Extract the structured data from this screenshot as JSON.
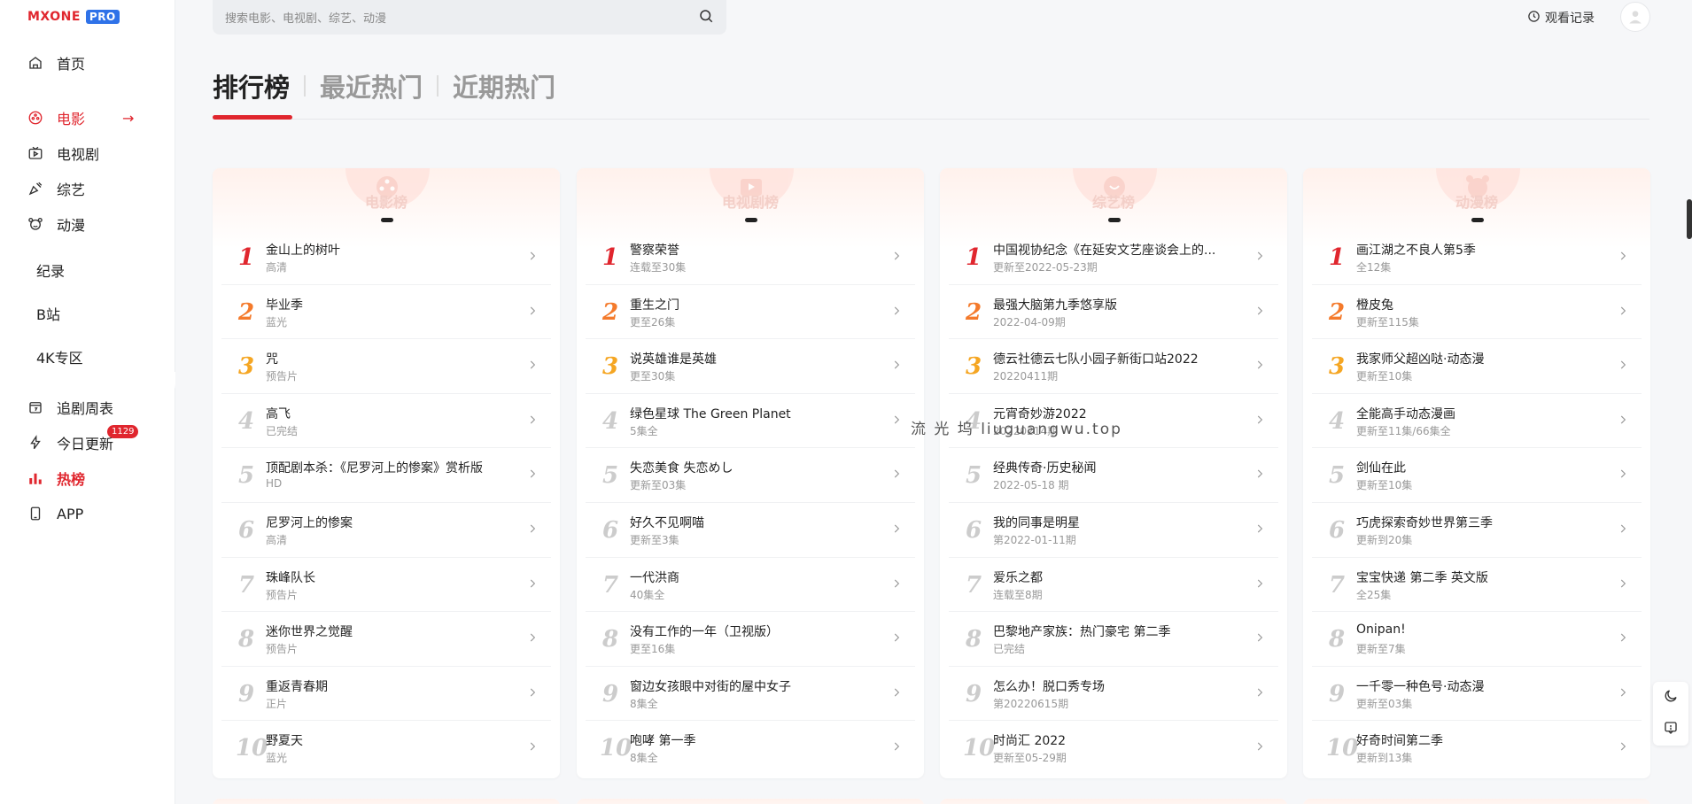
{
  "logo": {
    "brand": "MXONE",
    "pro": "PRO"
  },
  "search": {
    "placeholder": "搜索电影、电视剧、综艺、动漫"
  },
  "header": {
    "history_label": "观看记录"
  },
  "sidebar": {
    "items": [
      {
        "label": "首页",
        "icon": "home-icon"
      },
      {
        "label": "电影",
        "icon": "film-icon",
        "active": true
      },
      {
        "label": "电视剧",
        "icon": "tv-icon"
      },
      {
        "label": "综艺",
        "icon": "variety-icon"
      },
      {
        "label": "动漫",
        "icon": "anime-icon"
      }
    ],
    "subitems": [
      "纪录",
      "B站",
      "4K专区"
    ],
    "bottom_items": [
      {
        "label": "追剧周表",
        "icon": "calendar-icon"
      },
      {
        "label": "今日更新",
        "icon": "flash-icon",
        "badge": "1129"
      },
      {
        "label": "热榜",
        "icon": "chart-icon",
        "active": true
      },
      {
        "label": "APP",
        "icon": "phone-icon"
      }
    ]
  },
  "tabs": [
    "排行榜",
    "最近热门",
    "近期热门"
  ],
  "watermark": "流 光 坞 liuguangwu.top",
  "cards": [
    {
      "title": "电影榜",
      "rows": [
        {
          "rank": "1",
          "name": "金山上的树叶",
          "sub": "高清"
        },
        {
          "rank": "2",
          "name": "毕业季",
          "sub": "蓝光"
        },
        {
          "rank": "3",
          "name": "咒",
          "sub": "预告片"
        },
        {
          "rank": "4",
          "name": "高飞",
          "sub": "已完结"
        },
        {
          "rank": "5",
          "name": "顶配剧本杀：《尼罗河上的惨案》赏析版",
          "sub": "HD"
        },
        {
          "rank": "6",
          "name": "尼罗河上的惨案",
          "sub": "高清"
        },
        {
          "rank": "7",
          "name": "珠峰队长",
          "sub": "预告片"
        },
        {
          "rank": "8",
          "name": "迷你世界之觉醒",
          "sub": "预告片"
        },
        {
          "rank": "9",
          "name": "重返青春期",
          "sub": "正片"
        },
        {
          "rank": "10",
          "name": "野夏天",
          "sub": "蓝光"
        }
      ]
    },
    {
      "title": "电视剧榜",
      "rows": [
        {
          "rank": "1",
          "name": "警察荣誉",
          "sub": "连载至30集"
        },
        {
          "rank": "2",
          "name": "重生之门",
          "sub": "更至26集"
        },
        {
          "rank": "3",
          "name": "说英雄谁是英雄",
          "sub": "更至30集"
        },
        {
          "rank": "4",
          "name": "绿色星球 The Green Planet",
          "sub": "5集全"
        },
        {
          "rank": "5",
          "name": "失恋美食 失恋めし",
          "sub": "更新至03集"
        },
        {
          "rank": "6",
          "name": "好久不见啊喵",
          "sub": "更新至3集"
        },
        {
          "rank": "7",
          "name": "一代洪商",
          "sub": "40集全"
        },
        {
          "rank": "8",
          "name": "没有工作的一年（卫视版）",
          "sub": "更至16集"
        },
        {
          "rank": "9",
          "name": "窗边女孩眼中对街的屋中女子",
          "sub": "8集全"
        },
        {
          "rank": "10",
          "name": "咆哮 第一季",
          "sub": "8集全"
        }
      ]
    },
    {
      "title": "综艺榜",
      "rows": [
        {
          "rank": "1",
          "name": "中国视协纪念《在延安文艺座谈会上的...",
          "sub": "更新至2022-05-23期"
        },
        {
          "rank": "2",
          "name": "最强大脑第九季悠享版",
          "sub": "2022-04-09期"
        },
        {
          "rank": "3",
          "name": "德云社德云七队小园子新街口站2022",
          "sub": "20220411期"
        },
        {
          "rank": "4",
          "name": "元宵奇妙游2022",
          "sub": "20220214期"
        },
        {
          "rank": "5",
          "name": "经典传奇·历史秘闻",
          "sub": "2022-05-18 期"
        },
        {
          "rank": "6",
          "name": "我的同事是明星",
          "sub": "第2022-01-11期"
        },
        {
          "rank": "7",
          "name": "爱乐之都",
          "sub": "连载至8期"
        },
        {
          "rank": "8",
          "name": "巴黎地产家族：热门豪宅 第二季",
          "sub": "已完结"
        },
        {
          "rank": "9",
          "name": "怎么办！脱口秀专场",
          "sub": "第20220615期"
        },
        {
          "rank": "10",
          "name": "时尚汇 2022",
          "sub": "更新至05-29期"
        }
      ]
    },
    {
      "title": "动漫榜",
      "rows": [
        {
          "rank": "1",
          "name": "画江湖之不良人第5季",
          "sub": "全12集"
        },
        {
          "rank": "2",
          "name": "橙皮兔",
          "sub": "更新至115集"
        },
        {
          "rank": "3",
          "name": "我家师父超凶哒·动态漫",
          "sub": "更新至10集"
        },
        {
          "rank": "4",
          "name": "全能高手动态漫画",
          "sub": "更新至11集/66集全"
        },
        {
          "rank": "5",
          "name": "剑仙在此",
          "sub": "更新至10集"
        },
        {
          "rank": "6",
          "name": "巧虎探索奇妙世界第三季",
          "sub": "更新到20集"
        },
        {
          "rank": "7",
          "name": "宝宝快递 第二季 英文版",
          "sub": "全25集"
        },
        {
          "rank": "8",
          "name": "Onipan!",
          "sub": "更新至7集"
        },
        {
          "rank": "9",
          "name": "一千零一种色号·动态漫",
          "sub": "更新至03集"
        },
        {
          "rank": "10",
          "name": "好奇时间第二季",
          "sub": "更新到13集"
        }
      ]
    }
  ],
  "colors": {
    "accent": "#e0262e",
    "rank2": "#f47a2b",
    "rank3": "#f5a623"
  }
}
